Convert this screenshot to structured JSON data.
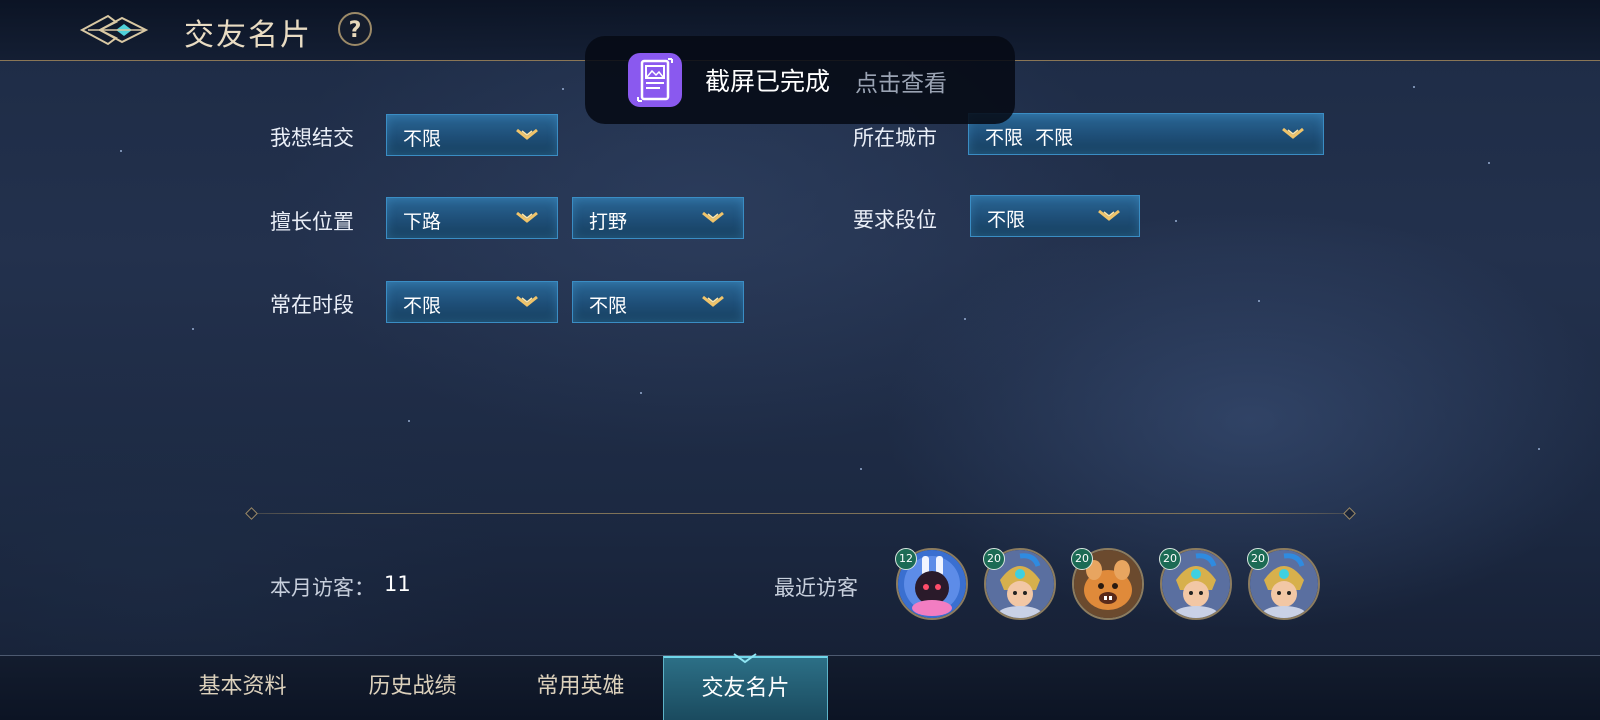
{
  "header": {
    "title": "交友名片",
    "help_label": "?"
  },
  "toast": {
    "message": "截屏已完成",
    "action": "点击查看"
  },
  "form": {
    "want_to_meet": {
      "label": "我想结交",
      "value": "不限"
    },
    "good_position": {
      "label": "擅长位置",
      "value1": "下路",
      "value2": "打野"
    },
    "active_time": {
      "label": "常在时段",
      "value1": "不限",
      "value2": "不限"
    },
    "city": {
      "label": "所在城市",
      "value": "不限  不限"
    },
    "required_rank": {
      "label": "要求段位",
      "value": "不限"
    }
  },
  "visitors": {
    "monthly_label": "本月访客：",
    "monthly_count": "11",
    "recent_label": "最近访客",
    "recent": [
      {
        "level": "12",
        "icon": "robot-rabbit-avatar"
      },
      {
        "level": "20",
        "icon": "helmet-warrior-avatar"
      },
      {
        "level": "20",
        "icon": "orange-beast-avatar"
      },
      {
        "level": "20",
        "icon": "helmet-warrior-avatar"
      },
      {
        "level": "20",
        "icon": "helmet-warrior-avatar"
      }
    ]
  },
  "tabs": [
    {
      "label": "基本资料",
      "active": false
    },
    {
      "label": "历史战绩",
      "active": false
    },
    {
      "label": "常用英雄",
      "active": false
    },
    {
      "label": "交友名片",
      "active": true
    }
  ],
  "colors": {
    "accent_gold": "#e9dcc3",
    "dropdown_blue": "#1e4e77",
    "toast_icon_purple": "#8a59ef",
    "level_badge_green": "#1c6b55"
  }
}
